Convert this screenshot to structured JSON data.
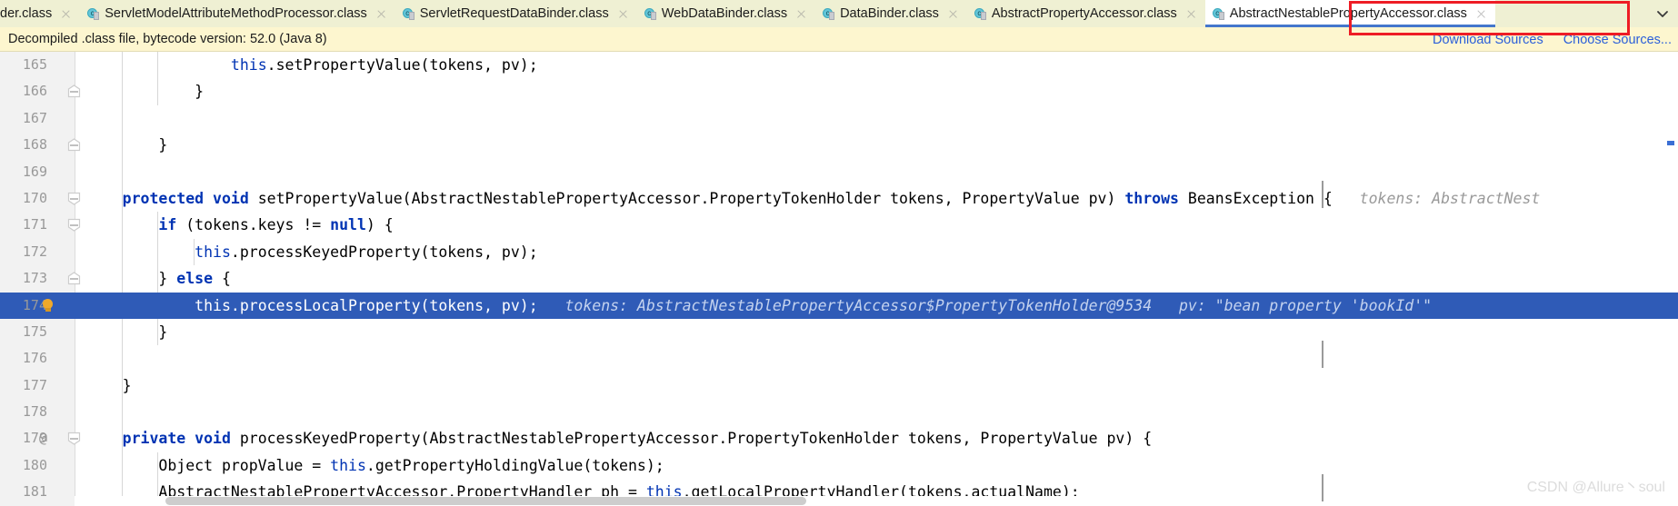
{
  "tabs": [
    {
      "label": "der.class",
      "icon": "java-class-icon",
      "partial": true,
      "active": false,
      "closable": true
    },
    {
      "label": "ServletModelAttributeMethodProcessor.class",
      "icon": "java-class-icon",
      "partial": false,
      "active": false,
      "closable": true
    },
    {
      "label": "ServletRequestDataBinder.class",
      "icon": "java-class-icon",
      "partial": false,
      "active": false,
      "closable": true
    },
    {
      "label": "WebDataBinder.class",
      "icon": "java-class-icon",
      "partial": false,
      "active": false,
      "closable": true
    },
    {
      "label": "DataBinder.class",
      "icon": "java-class-icon",
      "partial": false,
      "active": false,
      "closable": true
    },
    {
      "label": "AbstractPropertyAccessor.class",
      "icon": "java-class-icon",
      "partial": false,
      "active": false,
      "closable": true
    },
    {
      "label": "AbstractNestablePropertyAccessor.class",
      "icon": "java-class-icon",
      "partial": false,
      "active": true,
      "closable": true
    }
  ],
  "tab_overflow_icon": "chevron-down-icon",
  "annotation": {
    "shape": "rectangle",
    "color": "#ee1c25"
  },
  "notice": {
    "text": "Decompiled .class file, bytecode version: 52.0 (Java 8)",
    "download_sources_label": "Download Sources",
    "choose_sources_label": "Choose Sources..."
  },
  "editor": {
    "first_line_number": 165,
    "selected_line_number": 174,
    "gutter_icons": {
      "breakpoint_hint": "lightbulb-icon"
    },
    "lines": [
      {
        "n": 165,
        "fold": null,
        "at": false,
        "indent_guides": [
          1,
          2
        ],
        "tokens": [
          {
            "t": "                 ",
            "c": "plain"
          },
          {
            "t": "this",
            "c": "this"
          },
          {
            "t": ".setPropertyValue(tokens, pv);",
            "c": "plain"
          }
        ]
      },
      {
        "n": 166,
        "fold": "collapse",
        "at": false,
        "indent_guides": [
          1,
          2
        ],
        "tokens": [
          {
            "t": "             }",
            "c": "plain"
          }
        ]
      },
      {
        "n": 167,
        "fold": null,
        "at": false,
        "indent_guides": [
          1
        ],
        "tokens": [
          {
            "t": "",
            "c": "plain"
          }
        ]
      },
      {
        "n": 168,
        "fold": "collapse",
        "at": false,
        "indent_guides": [
          1
        ],
        "tokens": [
          {
            "t": "         }",
            "c": "plain"
          }
        ]
      },
      {
        "n": 169,
        "fold": null,
        "at": false,
        "indent_guides": [
          1
        ],
        "tokens": [
          {
            "t": "",
            "c": "plain"
          }
        ]
      },
      {
        "n": 170,
        "fold": "expand",
        "at": false,
        "indent_guides": [
          1
        ],
        "tokens": [
          {
            "t": "     ",
            "c": "plain"
          },
          {
            "t": "protected",
            "c": "kw"
          },
          {
            "t": " ",
            "c": "plain"
          },
          {
            "t": "void",
            "c": "kw"
          },
          {
            "t": " setPropertyValue(AbstractNestablePropertyAccessor.PropertyTokenHolder tokens, PropertyValue pv) ",
            "c": "plain"
          },
          {
            "t": "throws",
            "c": "kw"
          },
          {
            "t": " BeansException {",
            "c": "plain"
          },
          {
            "t": "   tokens: AbstractNest",
            "c": "hint"
          }
        ]
      },
      {
        "n": 171,
        "fold": "expand",
        "at": false,
        "indent_guides": [
          1,
          2
        ],
        "tokens": [
          {
            "t": "         ",
            "c": "plain"
          },
          {
            "t": "if",
            "c": "kw"
          },
          {
            "t": " (tokens.keys != ",
            "c": "plain"
          },
          {
            "t": "null",
            "c": "kw"
          },
          {
            "t": ") {",
            "c": "plain"
          }
        ]
      },
      {
        "n": 172,
        "fold": null,
        "at": false,
        "indent_guides": [
          1,
          2,
          3
        ],
        "tokens": [
          {
            "t": "             ",
            "c": "plain"
          },
          {
            "t": "this",
            "c": "this"
          },
          {
            "t": ".processKeyedProperty(tokens, pv);",
            "c": "plain"
          }
        ]
      },
      {
        "n": 173,
        "fold": "collapse",
        "at": false,
        "indent_guides": [
          1,
          2
        ],
        "tokens": [
          {
            "t": "         } ",
            "c": "plain"
          },
          {
            "t": "else",
            "c": "kw"
          },
          {
            "t": " {",
            "c": "plain"
          }
        ]
      },
      {
        "n": 174,
        "fold": null,
        "at": false,
        "selected": true,
        "indent_guides": [],
        "tokens": [
          {
            "t": "             ",
            "c": "plain"
          },
          {
            "t": "this",
            "c": "this"
          },
          {
            "t": ".processLocalProperty(tokens, pv);",
            "c": "plain"
          },
          {
            "t": "   tokens: AbstractNestablePropertyAccessor$PropertyTokenHolder@9534   pv: \"bean property 'bookId'\"",
            "c": "hint"
          }
        ]
      },
      {
        "n": 175,
        "fold": null,
        "at": false,
        "indent_guides": [
          1,
          2
        ],
        "tokens": [
          {
            "t": "         }",
            "c": "plain"
          }
        ]
      },
      {
        "n": 176,
        "fold": null,
        "at": false,
        "indent_guides": [
          1
        ],
        "tokens": [
          {
            "t": "",
            "c": "plain"
          }
        ]
      },
      {
        "n": 177,
        "fold": null,
        "at": false,
        "indent_guides": [
          1
        ],
        "tokens": [
          {
            "t": "     }",
            "c": "plain"
          }
        ]
      },
      {
        "n": 178,
        "fold": null,
        "at": false,
        "indent_guides": [
          1
        ],
        "tokens": [
          {
            "t": "",
            "c": "plain"
          }
        ]
      },
      {
        "n": 179,
        "fold": "expand",
        "at": true,
        "indent_guides": [
          1
        ],
        "tokens": [
          {
            "t": "     ",
            "c": "plain"
          },
          {
            "t": "private",
            "c": "kw"
          },
          {
            "t": " ",
            "c": "plain"
          },
          {
            "t": "void",
            "c": "kw"
          },
          {
            "t": " processKeyedProperty(AbstractNestablePropertyAccessor.PropertyTokenHolder tokens, PropertyValue pv) {",
            "c": "plain"
          }
        ]
      },
      {
        "n": 180,
        "fold": null,
        "at": false,
        "indent_guides": [
          1,
          2
        ],
        "tokens": [
          {
            "t": "         Object propValue = ",
            "c": "plain"
          },
          {
            "t": "this",
            "c": "this"
          },
          {
            "t": ".getPropertyHoldingValue(tokens);",
            "c": "plain"
          }
        ]
      },
      {
        "n": 181,
        "fold": null,
        "at": false,
        "indent_guides": [
          1,
          2
        ],
        "tokens": [
          {
            "t": "         AbstractNestablePropertyAccessor.PropertyHandler ph = ",
            "c": "plain"
          },
          {
            "t": "this",
            "c": "this"
          },
          {
            "t": ".getLocalPropertyHandler(tokens.actualName);",
            "c": "plain"
          }
        ]
      }
    ]
  },
  "scrollbar": {
    "orientation": "horizontal"
  },
  "watermark": {
    "text": "CSDN @Allure丶soul"
  },
  "colors": {
    "tabbar_bg": "#eff0d3",
    "notice_bg": "#fdf6cf",
    "active_tab_underline": "#4477cc",
    "selection_bg": "#2f5bb7",
    "keyword": "#0033b3",
    "hint": "#9a9a9a",
    "link": "#2b5fd9",
    "annotation": "#ee1c25"
  }
}
